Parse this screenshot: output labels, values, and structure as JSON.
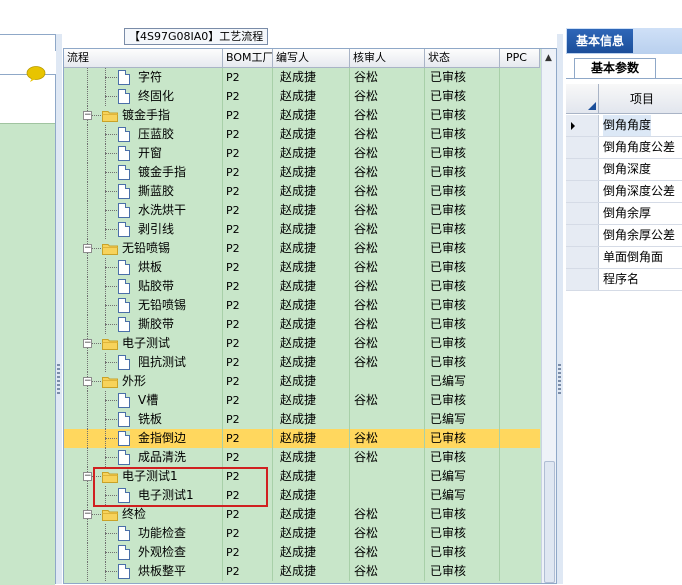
{
  "doc_title": "【4S97G08IA0】工艺流程",
  "columns": [
    "流程",
    "BOM工厂",
    "编写人",
    "核审人",
    "状态",
    "PPC"
  ],
  "rows": [
    {
      "name": "字符",
      "level": 2,
      "type": "doc",
      "bom": "P2",
      "writer": "赵成捷",
      "reviewer": "谷松",
      "status": "已审核"
    },
    {
      "name": "终固化",
      "level": 2,
      "type": "doc",
      "bom": "P2",
      "writer": "赵成捷",
      "reviewer": "谷松",
      "status": "已审核"
    },
    {
      "name": "镀金手指",
      "level": 1,
      "type": "folder",
      "bom": "P2",
      "writer": "赵成捷",
      "reviewer": "谷松",
      "status": "已审核"
    },
    {
      "name": "压蓝胶",
      "level": 2,
      "type": "doc",
      "bom": "P2",
      "writer": "赵成捷",
      "reviewer": "谷松",
      "status": "已审核"
    },
    {
      "name": "开窗",
      "level": 2,
      "type": "doc",
      "bom": "P2",
      "writer": "赵成捷",
      "reviewer": "谷松",
      "status": "已审核"
    },
    {
      "name": "镀金手指",
      "level": 2,
      "type": "doc",
      "bom": "P2",
      "writer": "赵成捷",
      "reviewer": "谷松",
      "status": "已审核"
    },
    {
      "name": "撕蓝胶",
      "level": 2,
      "type": "doc",
      "bom": "P2",
      "writer": "赵成捷",
      "reviewer": "谷松",
      "status": "已审核"
    },
    {
      "name": "水洗烘干",
      "level": 2,
      "type": "doc",
      "bom": "P2",
      "writer": "赵成捷",
      "reviewer": "谷松",
      "status": "已审核"
    },
    {
      "name": "剥引线",
      "level": 2,
      "type": "doc",
      "bom": "P2",
      "writer": "赵成捷",
      "reviewer": "谷松",
      "status": "已审核"
    },
    {
      "name": "无铅喷锡",
      "level": 1,
      "type": "folder",
      "bom": "P2",
      "writer": "赵成捷",
      "reviewer": "谷松",
      "status": "已审核"
    },
    {
      "name": "烘板",
      "level": 2,
      "type": "doc",
      "bom": "P2",
      "writer": "赵成捷",
      "reviewer": "谷松",
      "status": "已审核"
    },
    {
      "name": "贴胶带",
      "level": 2,
      "type": "doc",
      "bom": "P2",
      "writer": "赵成捷",
      "reviewer": "谷松",
      "status": "已审核"
    },
    {
      "name": "无铅喷锡",
      "level": 2,
      "type": "doc",
      "bom": "P2",
      "writer": "赵成捷",
      "reviewer": "谷松",
      "status": "已审核"
    },
    {
      "name": "撕胶带",
      "level": 2,
      "type": "doc",
      "bom": "P2",
      "writer": "赵成捷",
      "reviewer": "谷松",
      "status": "已审核"
    },
    {
      "name": "电子测试",
      "level": 1,
      "type": "folder",
      "bom": "P2",
      "writer": "赵成捷",
      "reviewer": "谷松",
      "status": "已审核"
    },
    {
      "name": "阻抗测试",
      "level": 2,
      "type": "doc",
      "bom": "P2",
      "writer": "赵成捷",
      "reviewer": "谷松",
      "status": "已审核"
    },
    {
      "name": "外形",
      "level": 1,
      "type": "folder",
      "bom": "P2",
      "writer": "赵成捷",
      "reviewer": "",
      "status": "已编写"
    },
    {
      "name": "V槽",
      "level": 2,
      "type": "doc",
      "bom": "P2",
      "writer": "赵成捷",
      "reviewer": "谷松",
      "status": "已审核"
    },
    {
      "name": "铣板",
      "level": 2,
      "type": "doc",
      "bom": "P2",
      "writer": "赵成捷",
      "reviewer": "",
      "status": "已编写"
    },
    {
      "name": "金指倒边",
      "level": 2,
      "type": "doc",
      "bom": "P2",
      "writer": "赵成捷",
      "reviewer": "谷松",
      "status": "已审核",
      "selected": true
    },
    {
      "name": "成品清洗",
      "level": 2,
      "type": "doc",
      "bom": "P2",
      "writer": "赵成捷",
      "reviewer": "谷松",
      "status": "已审核"
    },
    {
      "name": "电子测试1",
      "level": 1,
      "type": "folder",
      "bom": "P2",
      "writer": "赵成捷",
      "reviewer": "",
      "status": "已编写"
    },
    {
      "name": "电子测试1",
      "level": 2,
      "type": "doc",
      "bom": "P2",
      "writer": "赵成捷",
      "reviewer": "",
      "status": "已编写"
    },
    {
      "name": "终检",
      "level": 1,
      "type": "folder",
      "bom": "P2",
      "writer": "赵成捷",
      "reviewer": "谷松",
      "status": "已审核"
    },
    {
      "name": "功能检查",
      "level": 2,
      "type": "doc",
      "bom": "P2",
      "writer": "赵成捷",
      "reviewer": "谷松",
      "status": "已审核"
    },
    {
      "name": "外观检查",
      "level": 2,
      "type": "doc",
      "bom": "P2",
      "writer": "赵成捷",
      "reviewer": "谷松",
      "status": "已审核"
    },
    {
      "name": "烘板整平",
      "level": 2,
      "type": "doc",
      "bom": "P2",
      "writer": "赵成捷",
      "reviewer": "谷松",
      "status": "已审核"
    }
  ],
  "right_panel": {
    "tab_label": "基本信息",
    "subtab_label": "基本参数",
    "header_label": "项目",
    "items": [
      "倒角角度",
      "倒角角度公差",
      "倒角深度",
      "倒角深度公差",
      "倒角余厚",
      "倒角余厚公差",
      "单面倒角面",
      "程序名"
    ],
    "current_index": 0
  },
  "colors": {
    "row_bg": "#c8e6c9",
    "selected_bg": "#ffd75e",
    "tab_blue": "#1b4e9a",
    "highlight_box": "#d02020"
  }
}
